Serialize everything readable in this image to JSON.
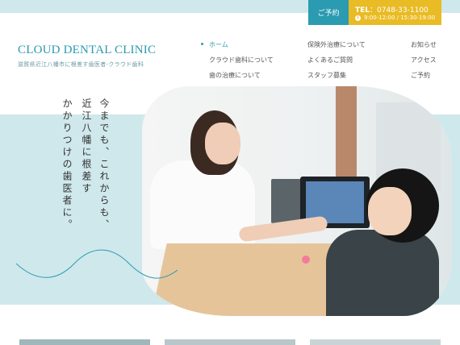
{
  "header": {
    "reserve_label": "ご予約",
    "tel_label": "TEL",
    "tel_number": "：0748-33-1100",
    "hours": "9:00-12:00 / 15:30-19:00"
  },
  "brand": {
    "logo": "CLOUD DENTAL CLINIC",
    "tagline": "滋賀県近江八幡市に根差す歯医者-クラウド歯科"
  },
  "nav": {
    "home": "ホーム",
    "about": "クラウド歯科について",
    "treatment": "歯の治療について",
    "insurance": "保険外治療について",
    "faq": "よくあるご質問",
    "recruit": "スタッフ募集",
    "news": "お知らせ",
    "access": "アクセス",
    "reserve": "ご予約"
  },
  "hero": {
    "copy_line1": "今までも、これからも、",
    "copy_line2": "近江八幡に根差す",
    "copy_line3": "かかりつけの歯医者に。"
  },
  "colors": {
    "accent": "#2a9bb0",
    "light_band": "#cfe8ec",
    "tel_bg": "#e9bb24"
  }
}
